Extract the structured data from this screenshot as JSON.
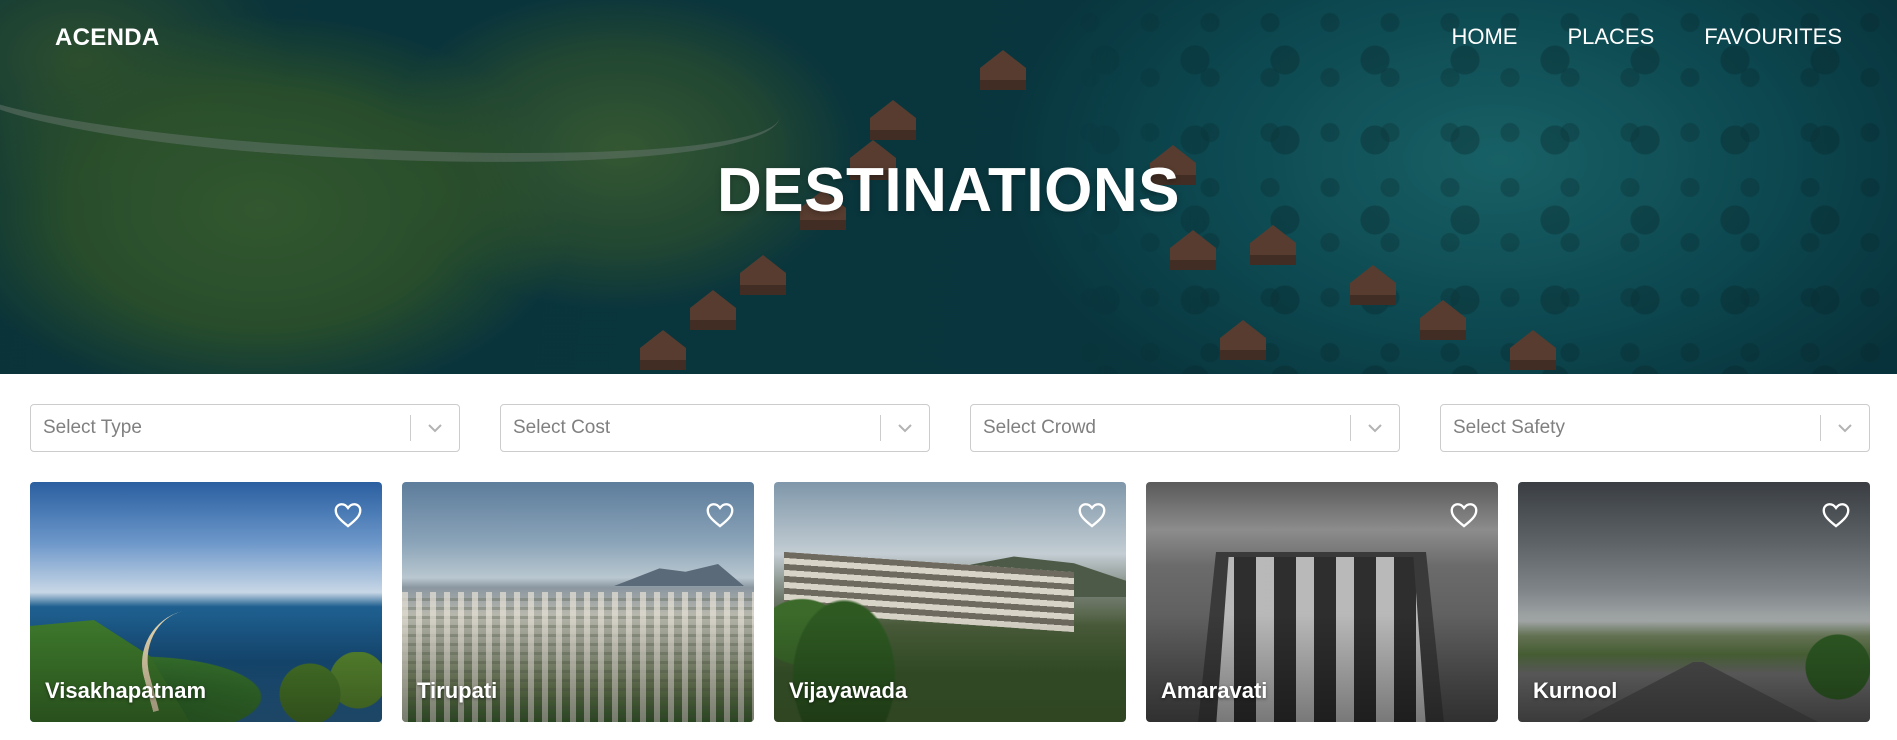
{
  "nav": {
    "brand": "ACENDA",
    "links": [
      "HOME",
      "PLACES",
      "FAVOURITES"
    ]
  },
  "hero": {
    "title": "DESTINATIONS"
  },
  "filters": [
    {
      "placeholder": "Select Type"
    },
    {
      "placeholder": "Select Cost"
    },
    {
      "placeholder": "Select Crowd"
    },
    {
      "placeholder": "Select Safety"
    }
  ],
  "cards": [
    {
      "name": "Visakhapatnam",
      "icon": "heart-outline-icon"
    },
    {
      "name": "Tirupati",
      "icon": "heart-outline-icon"
    },
    {
      "name": "Vijayawada",
      "icon": "heart-outline-icon"
    },
    {
      "name": "Amaravati",
      "icon": "heart-outline-icon"
    },
    {
      "name": "Kurnool",
      "icon": "heart-outline-icon"
    }
  ],
  "colors": {
    "nav_text": "#ffffff",
    "select_border": "#cccccc",
    "placeholder": "#808080",
    "card_title": "#ffffff"
  }
}
